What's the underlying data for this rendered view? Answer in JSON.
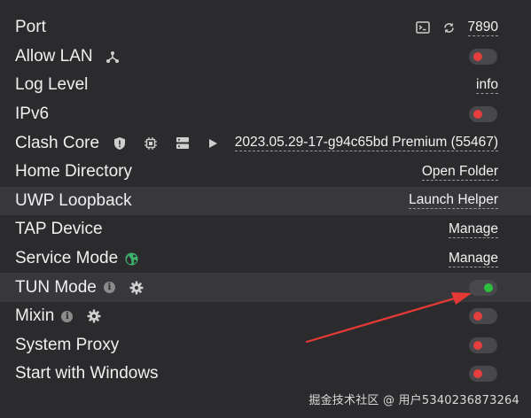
{
  "settings": {
    "port": {
      "label": "Port",
      "value": "7890"
    },
    "allow_lan": {
      "label": "Allow LAN",
      "enabled": false
    },
    "log_level": {
      "label": "Log Level",
      "value": "info"
    },
    "ipv6": {
      "label": "IPv6",
      "enabled": false
    },
    "clash_core": {
      "label": "Clash Core",
      "value": "2023.05.29-17-g94c65bd Premium (55467)"
    },
    "home_directory": {
      "label": "Home Directory",
      "action": "Open Folder"
    },
    "uwp_loopback": {
      "label": "UWP Loopback",
      "action": "Launch Helper"
    },
    "tap_device": {
      "label": "TAP Device",
      "action": "Manage"
    },
    "service_mode": {
      "label": "Service Mode",
      "action": "Manage"
    },
    "tun_mode": {
      "label": "TUN Mode",
      "enabled": true
    },
    "mixin": {
      "label": "Mixin",
      "enabled": false
    },
    "system_proxy": {
      "label": "System Proxy",
      "enabled": false
    },
    "start_with_windows": {
      "label": "Start with Windows",
      "enabled": false
    }
  },
  "info_glyph": "i",
  "watermark": "掘金技术社区 @ 用户5340236873264",
  "colors": {
    "background": "#2b2b2e",
    "highlight_row": "#38383c",
    "toggle_off": "#e53e3e",
    "toggle_on": "#2fbf3f",
    "globe": "#3fb36b",
    "annotation_arrow": "#e53935"
  },
  "icons": {
    "port": [
      "terminal-icon",
      "refresh-icon"
    ],
    "allow_lan": [
      "network-icon"
    ],
    "clash_core": [
      "shield-icon",
      "chip-icon",
      "server-icon",
      "play-icon"
    ],
    "service_mode": [
      "globe-icon"
    ],
    "tun_mode": [
      "info-icon",
      "gear-icon"
    ],
    "mixin": [
      "info-icon",
      "gear-icon"
    ]
  }
}
